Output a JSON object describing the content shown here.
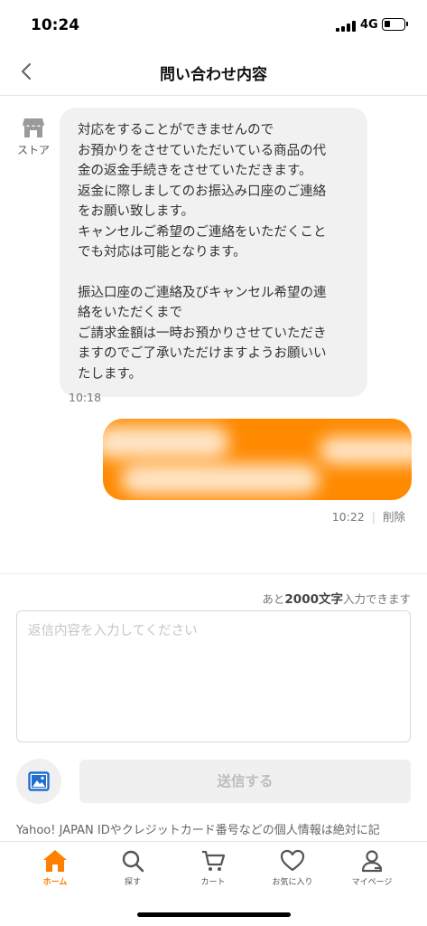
{
  "status": {
    "time": "10:24",
    "network": "4G",
    "battery_level": 0.3
  },
  "header": {
    "title": "問い合わせ内容"
  },
  "chat": {
    "store_label": "ストア",
    "incoming": {
      "paragraph1": "対応をすることができませんので\nお預かりをさせていただいている商品の代\n金の返金手続きをさせていただきます。\n返金に際しましてのお振込み口座のご連絡\nをお願い致します。\nキャンセルご希望のご連絡をいただくこと\nでも対応は可能となります。",
      "paragraph2": "振込口座のご連絡及びキャンセル希望の連\n絡をいただくまで\nご請求金額は一時お預かりさせていただき\nますのでご了承いただけますようお願いい\nたします。",
      "time": "10:18"
    },
    "outgoing": {
      "time": "10:22",
      "delete_label": "削除"
    }
  },
  "composer": {
    "counter_prefix": "あと",
    "counter_value": "2000文字",
    "counter_suffix": "入力できます",
    "placeholder": "返信内容を入力してください",
    "send_label": "送信する",
    "notice": "Yahoo! JAPAN IDやクレジットカード番号などの個人情報は絶対に記"
  },
  "tabs": [
    {
      "label": "ホーム",
      "icon": "home-icon",
      "active": true
    },
    {
      "label": "探す",
      "icon": "search-icon"
    },
    {
      "label": "カート",
      "icon": "cart-icon"
    },
    {
      "label": "お気に入り",
      "icon": "heart-icon"
    },
    {
      "label": "マイページ",
      "icon": "user-icon"
    }
  ],
  "colors": {
    "accent": "#ff7f00",
    "outgoing_bubble": "#ff8a00",
    "incoming_bubble": "#f1f1f1"
  }
}
